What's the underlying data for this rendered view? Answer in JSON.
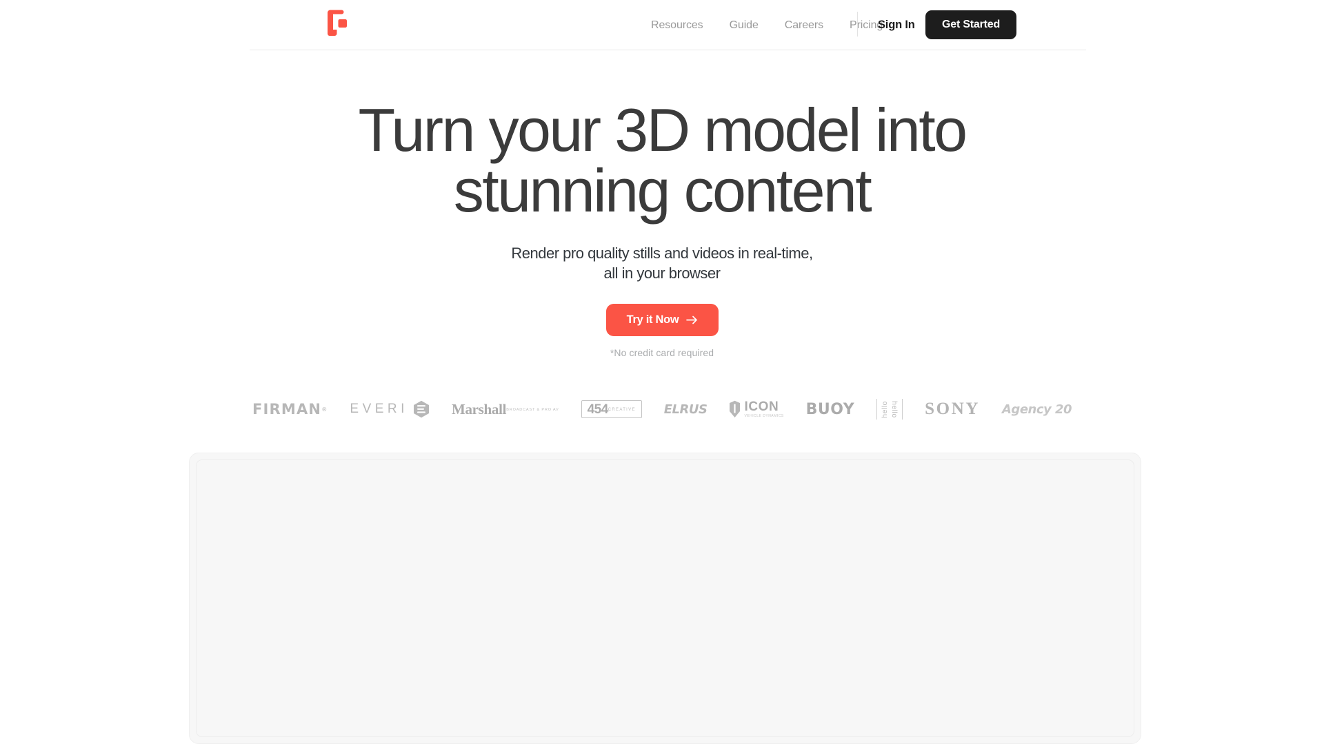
{
  "brand": {
    "logo_icon": "geometric-g-logo",
    "logo_color": "#fb5445"
  },
  "header": {
    "nav_links": [
      {
        "label": "Resources"
      },
      {
        "label": "Guide"
      },
      {
        "label": "Careers"
      },
      {
        "label": "Pricing"
      }
    ],
    "sign_in_label": "Sign In",
    "get_started_label": "Get Started"
  },
  "hero": {
    "headline": "Turn your 3D model into\nstunning content",
    "subtitle": "Render pro quality stills and videos in real-time,\nall in your browser",
    "cta_label": "Try it Now",
    "cta_icon": "arrow-right-icon",
    "cta_color": "#fb5445",
    "note": "*No credit card required"
  },
  "client_logos": [
    {
      "name": "FIRMAN",
      "mark": "firman-logo"
    },
    {
      "name": "EVERI",
      "mark": "everi-logo"
    },
    {
      "name": "Marshall",
      "tagline": "BROADCAST & PRO AV",
      "mark": "marshall-logo"
    },
    {
      "name": "454",
      "tagline": "CREATIVE",
      "mark": "454-creative-logo"
    },
    {
      "name": "ELRUS",
      "mark": "elrus-logo"
    },
    {
      "name": "ICON",
      "tagline": "VEHICLE DYNAMICS",
      "mark": "icon-logo"
    },
    {
      "name": "BUOY",
      "mark": "buoy-logo"
    },
    {
      "name": "hello hello",
      "mark": "hello-hello-logo"
    },
    {
      "name": "SONY",
      "mark": "sony-logo"
    },
    {
      "name": "Agency 20",
      "mark": "agency20-logo"
    }
  ],
  "preview_panel": {
    "background": "#f7f7f7",
    "border_color": "#ededed"
  }
}
